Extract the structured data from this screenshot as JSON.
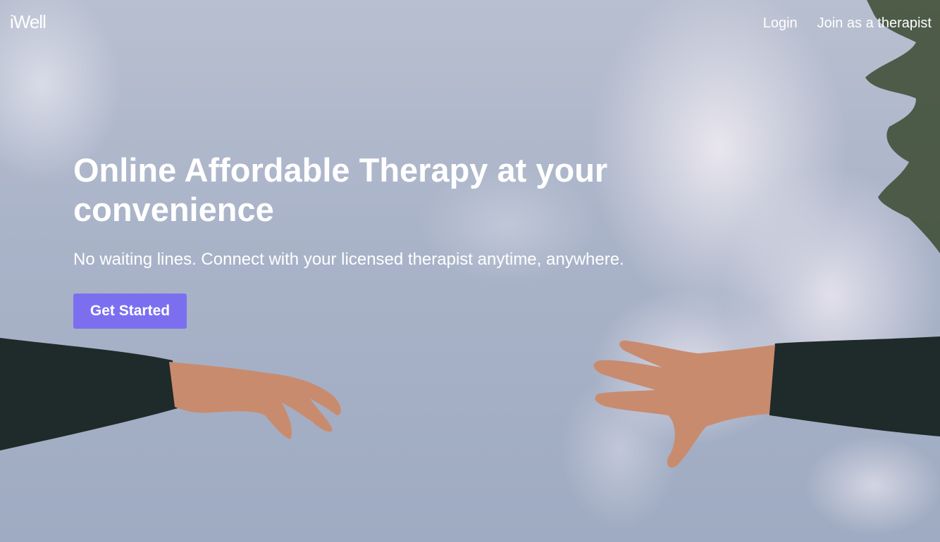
{
  "brand": {
    "logo_text": "iWell"
  },
  "nav": {
    "login_label": "Login",
    "join_label": "Join as a therapist"
  },
  "hero": {
    "title": "Online Affordable Therapy at your convenience",
    "subtitle": "No waiting lines. Connect with your licensed therapist anytime, anywhere.",
    "cta_label": "Get Started"
  },
  "colors": {
    "accent": "#7b6ff0",
    "text": "#ffffff",
    "sleeve": "#1f2a2a",
    "skin": "#c98b6e"
  },
  "background": {
    "image_name": "sky-with-reaching-hands"
  }
}
